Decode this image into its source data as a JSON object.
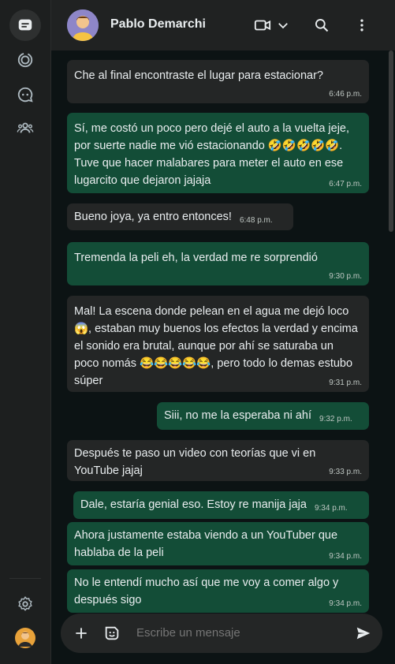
{
  "header": {
    "contact_name": "Pablo Demarchi"
  },
  "messages": [
    {
      "dir": "in",
      "text": "Che al final encontraste el lugar para estacionar?",
      "time": "6:46 p.m."
    },
    {
      "dir": "out",
      "text": "Sí, me costó un poco pero dejé el auto a la vuelta jeje, por suerte nadie me vió estacionando 🤣🤣🤣🤣🤣. Tuve que hacer malabares para meter el auto en ese lugarcito que dejaron jajaja",
      "time": "6:47 p.m."
    },
    {
      "dir": "in",
      "text": "Bueno joya, ya entro entonces!",
      "time": "6:48 p.m."
    },
    {
      "dir": "out",
      "text": "Tremenda la peli eh, la verdad me re sorprendió",
      "time": "9:30 p.m."
    },
    {
      "dir": "in",
      "text": "Mal! La escena donde pelean en el agua me dejó loco 😱, estaban muy buenos los efectos la verdad y encima el sonido era brutal, aunque por ahí se saturaba un poco nomás 😂😂😂😂😂, pero todo lo demas estubo súper",
      "time": "9:31 p.m."
    },
    {
      "dir": "out",
      "text": "Siii, no me la esperaba ni ahí",
      "time": "9:32 p.m."
    },
    {
      "dir": "in",
      "text": "Después te paso un video con teorías que vi en YouTube jajaj",
      "time": "9:33 p.m."
    },
    {
      "dir": "out",
      "text": "Dale, estaría genial eso. Estoy re manija jaja",
      "time": "9:34 p.m."
    },
    {
      "dir": "out",
      "text": "Ahora justamente estaba viendo a un YouTuber que hablaba de la peli",
      "time": "9:34 p.m."
    },
    {
      "dir": "out",
      "text": "No le entendí mucho así que me voy a comer algo y después sigo",
      "time": "9:34 p.m."
    }
  ],
  "composer": {
    "placeholder": "Escribe un mensaje"
  },
  "colors": {
    "incoming": "#242626",
    "outgoing": "#134d37",
    "background": "#0c1314"
  },
  "icons": {
    "rail": [
      "chats-icon",
      "status-icon",
      "channels-icon",
      "communities-icon",
      "settings-icon",
      "profile-avatar"
    ],
    "header": [
      "video-call-icon",
      "chevron-down-icon",
      "search-icon",
      "more-options-icon"
    ],
    "composer": [
      "attach-plus-icon",
      "sticker-icon",
      "send-icon"
    ]
  }
}
